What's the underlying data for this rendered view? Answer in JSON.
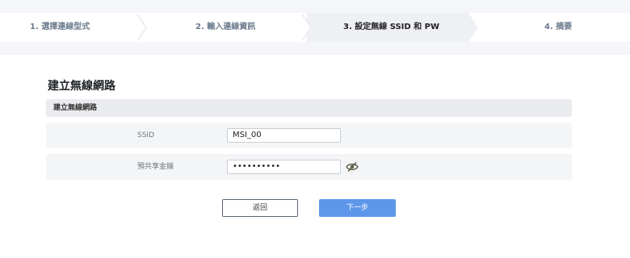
{
  "stepper": {
    "steps": [
      {
        "label": "1. 選擇連線型式"
      },
      {
        "label": "2. 輸入連線資訊"
      },
      {
        "label": "3. 設定無線 SSID 和 PW"
      },
      {
        "label": "4. 摘要"
      }
    ],
    "active_index": 2
  },
  "page": {
    "title": "建立無線網路",
    "section_header": "建立無線網路"
  },
  "form": {
    "ssid_label": "SSID",
    "ssid_value": "MSI_00",
    "psk_label": "預共享金鑰",
    "psk_value": "••••••••••",
    "psk_visibility_icon": "eye-slash-icon"
  },
  "buttons": {
    "back_label": "返回",
    "next_label": "下一步"
  },
  "colors": {
    "accent": "#5e97ea"
  }
}
